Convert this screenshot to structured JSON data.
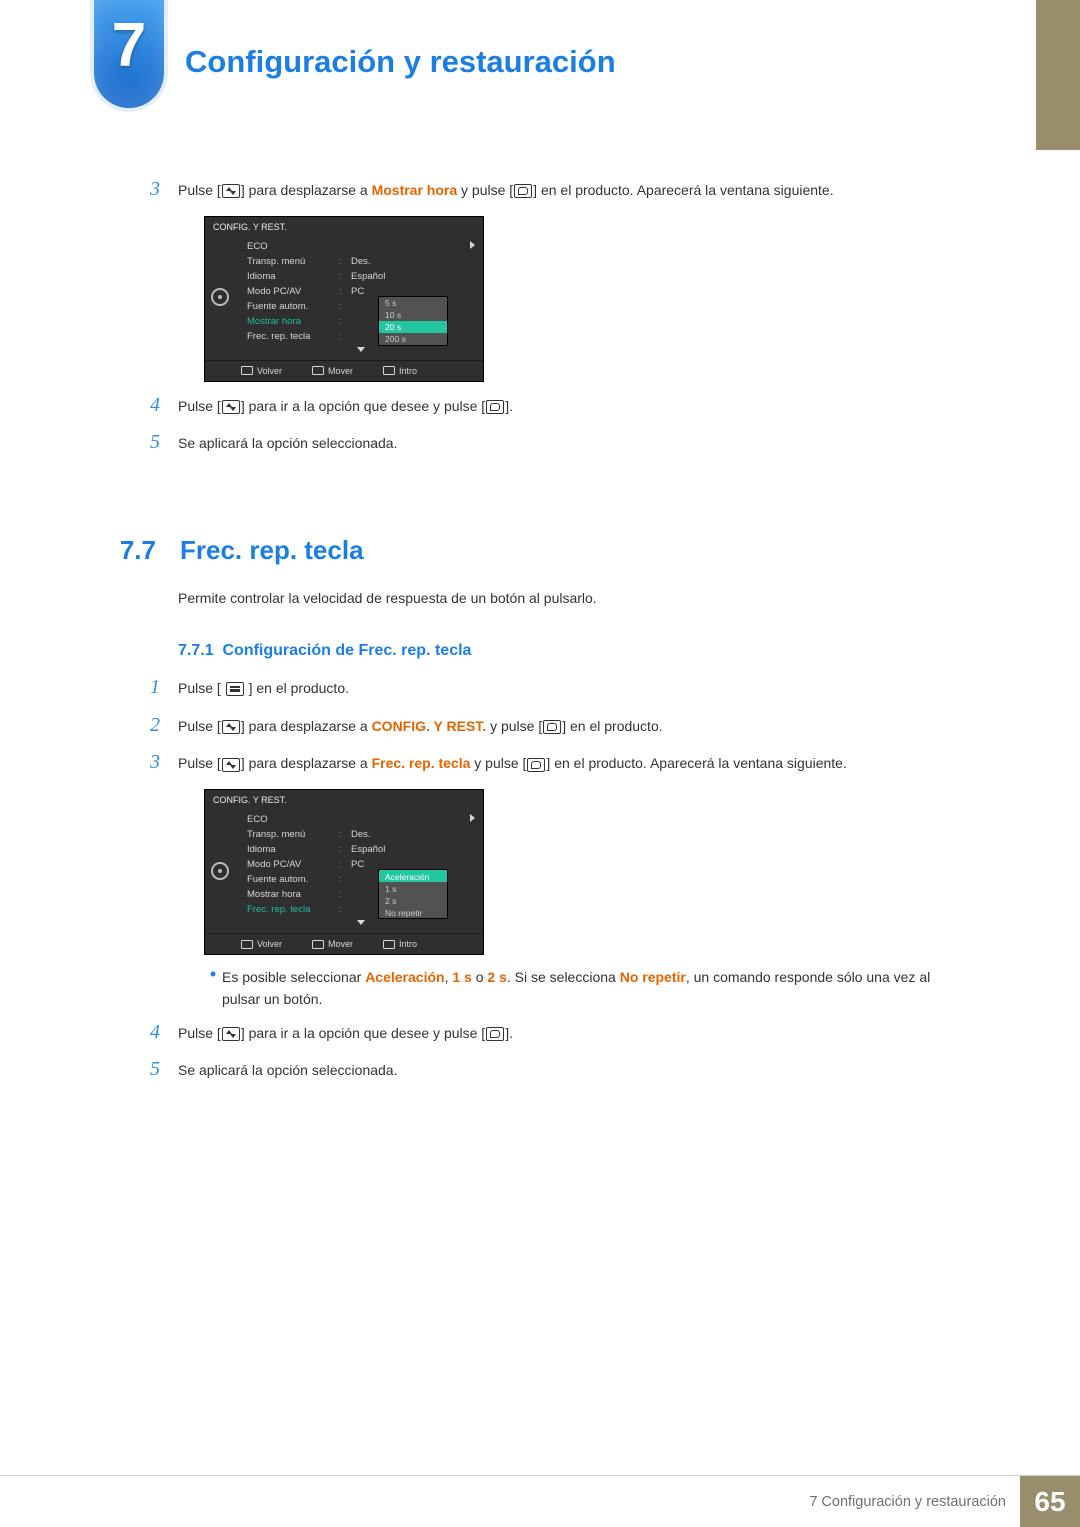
{
  "chapter": {
    "number": "7",
    "title": "Configuración y restauración"
  },
  "steps_a": {
    "s3": {
      "num": "3",
      "t1": "Pulse [",
      "t2": "] para desplazarse a ",
      "target": "Mostrar hora",
      "t3": " y pulse [",
      "t4": "] en el producto. Aparecerá la ventana siguiente."
    },
    "s4": {
      "num": "4",
      "t1": "Pulse [",
      "t2": "] para ir a la opción que desee y pulse [",
      "t3": "]."
    },
    "s5": {
      "num": "5",
      "text": "Se aplicará la opción seleccionada."
    }
  },
  "osd1": {
    "title": "CONFIG. Y REST.",
    "rows": [
      {
        "label": "ECO",
        "val": ""
      },
      {
        "label": "Transp. menú",
        "val": "Des."
      },
      {
        "label": "Idioma",
        "val": "Español"
      },
      {
        "label": "Modo PC/AV",
        "val": "PC"
      },
      {
        "label": "Fuente autom.",
        "val": ""
      },
      {
        "label": "Mostrar hora",
        "val": ""
      },
      {
        "label": "Frec. rep. tecla",
        "val": ""
      }
    ],
    "popup": [
      "5 s",
      "10 s",
      "20 s",
      "200 s"
    ],
    "popup_hi": 2,
    "footer": {
      "back": "Volver",
      "move": "Mover",
      "enter": "Intro"
    }
  },
  "section": {
    "num": "7.7",
    "title": "Frec. rep. tecla",
    "intro": "Permite controlar la velocidad de respuesta de un botón al pulsarlo.",
    "sub_num": "7.7.1",
    "sub_title": "Configuración de Frec. rep. tecla"
  },
  "steps_b": {
    "s1": {
      "num": "1",
      "t1": "Pulse [ ",
      "t2": " ] en el producto."
    },
    "s2": {
      "num": "2",
      "t1": "Pulse [",
      "t2": "] para desplazarse a ",
      "target": "CONFIG. Y REST.",
      "t3": " y pulse [",
      "t4": "] en el producto."
    },
    "s3": {
      "num": "3",
      "t1": "Pulse [",
      "t2": "] para desplazarse a ",
      "target": "Frec. rep. tecla",
      "t3": " y pulse [",
      "t4": "] en el producto. Aparecerá la ventana siguiente."
    }
  },
  "osd2": {
    "title": "CONFIG. Y REST.",
    "rows": [
      {
        "label": "ECO",
        "val": ""
      },
      {
        "label": "Transp. menú",
        "val": "Des."
      },
      {
        "label": "Idioma",
        "val": "Español"
      },
      {
        "label": "Modo PC/AV",
        "val": "PC"
      },
      {
        "label": "Fuente autom.",
        "val": ""
      },
      {
        "label": "Mostrar hora",
        "val": ""
      },
      {
        "label": "Frec. rep. tecla",
        "val": ""
      }
    ],
    "popup": [
      "Aceleración",
      "1 s",
      "2 s",
      "No repetir"
    ],
    "popup_hi": 0,
    "footer": {
      "back": "Volver",
      "move": "Mover",
      "enter": "Intro"
    }
  },
  "note": {
    "t1": "Es posible seleccionar ",
    "o1": "Aceleración",
    "sep1": ", ",
    "o2": "1 s",
    "sep2": " o ",
    "o3": "2 s",
    "t2": ". Si se selecciona ",
    "o4": "No repetir",
    "t3": ", un comando responde sólo una vez al pulsar un botón."
  },
  "steps_c": {
    "s4": {
      "num": "4",
      "t1": "Pulse [",
      "t2": "] para ir a la opción que desee y pulse [",
      "t3": "]."
    },
    "s5": {
      "num": "5",
      "text": "Se aplicará la opción seleccionada."
    }
  },
  "footer": {
    "name": "7 Configuración y restauración",
    "page": "65"
  }
}
